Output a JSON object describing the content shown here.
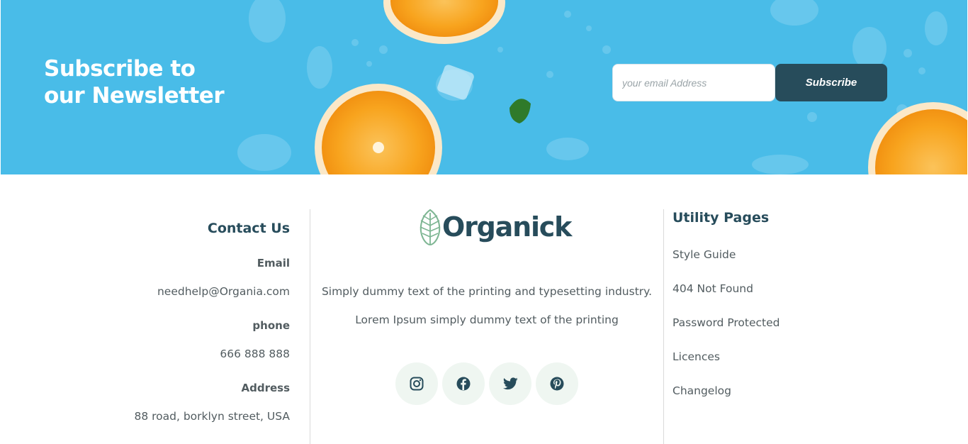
{
  "newsletter": {
    "title_line1": "Subscribe to",
    "title_line2": "our Newsletter",
    "email_placeholder": "your email Address",
    "subscribe_label": "Subscribe"
  },
  "contact": {
    "title": "Contact Us",
    "email_label": "Email",
    "email_value": "needhelp@Organia.com",
    "phone_label": "phone",
    "phone_value": "666 888 888",
    "address_label": "Address",
    "address_value": "88 road, borklyn street, USA"
  },
  "brand": {
    "name": "Organick",
    "description_line1": "Simply dummy text of the printing and typesetting industry.",
    "description_line2": "Lorem Ipsum simply dummy text of the printing",
    "socials": [
      {
        "icon": "instagram-icon"
      },
      {
        "icon": "facebook-icon"
      },
      {
        "icon": "twitter-icon"
      },
      {
        "icon": "pinterest-icon"
      }
    ]
  },
  "utility": {
    "title": "Utility Pages",
    "links": [
      "Style Guide",
      "404 Not Found",
      "Password Protected",
      "Licences",
      "Changelog"
    ]
  },
  "colors": {
    "banner_blue": "#49bce8",
    "primary_dark": "#274c5b",
    "text_gray": "#525c60",
    "social_bg": "#eff6f1",
    "logo_green": "#7eb693",
    "orange": "#f8a41e"
  }
}
